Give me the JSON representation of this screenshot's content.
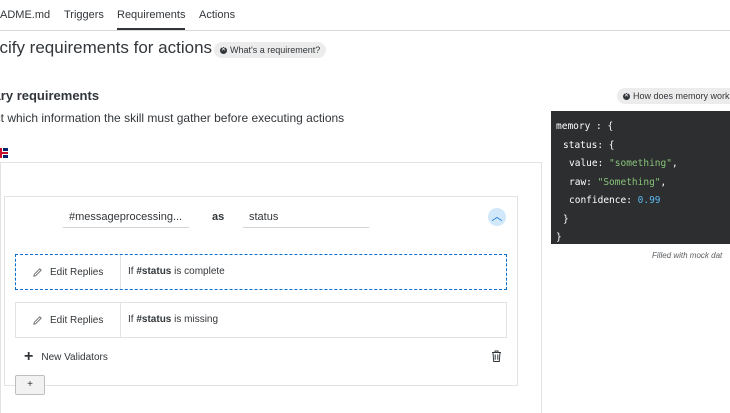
{
  "tabs": [
    {
      "label": "ADME.md",
      "active": false
    },
    {
      "label": "Triggers",
      "active": false
    },
    {
      "label": "Requirements",
      "active": true
    },
    {
      "label": "Actions",
      "active": false
    }
  ],
  "header": {
    "title": "ecify requirements for actions",
    "help_pill": "What's a requirement?"
  },
  "section": {
    "title": "mary requirements",
    "subtitle": "ect which information the skill must gather before executing actions",
    "language_flag": "uk-flag-icon"
  },
  "requirement": {
    "intent_value": "#messageprocessing...",
    "as_label": "as",
    "variable_value": "status",
    "collapse_icon": "chevron-up-icon"
  },
  "validators": [
    {
      "edit_label": "Edit Replies",
      "prefix": "If",
      "variable": "#status",
      "suffix": "is complete",
      "selected": true
    },
    {
      "edit_label": "Edit Replies",
      "prefix": "If",
      "variable": "#status",
      "suffix": "is missing",
      "selected": false
    }
  ],
  "new_validators_label": "New Validators",
  "add_button_label": "+",
  "memory": {
    "help_pill": "How does memory work?",
    "lines": {
      "l1": "memory : {",
      "l2": "status: {",
      "l3_key": "value: ",
      "l3_val": "\"something\"",
      "l3_end": ",",
      "l4_key": "raw: ",
      "l4_val": "\"Something\"",
      "l4_end": ",",
      "l5_key": "confidence: ",
      "l5_val": "0.99",
      "l6": "}",
      "l7": "}"
    },
    "note": "Filled with mock dat"
  },
  "colors": {
    "accent": "#0a6ed1",
    "code_bg": "#2c2e30",
    "code_string": "#89c379",
    "code_number": "#5cb8f1"
  }
}
